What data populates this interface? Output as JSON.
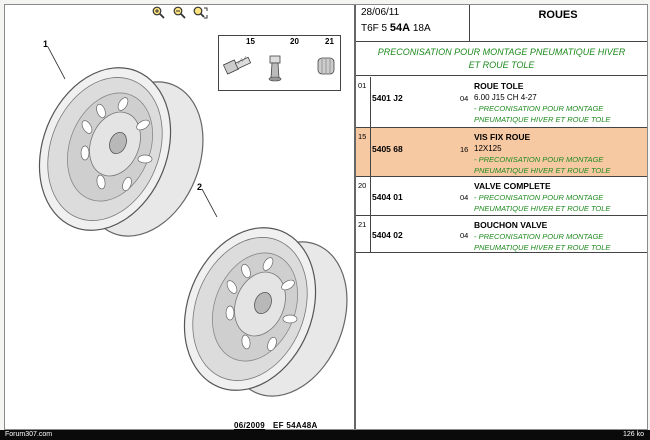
{
  "toolbar": {
    "tools": [
      {
        "name": "zoom-in-icon"
      },
      {
        "name": "zoom-out-icon"
      },
      {
        "name": "zoom-fit-icon"
      }
    ]
  },
  "drawing": {
    "callouts": [
      "1",
      "2"
    ],
    "small_parts": [
      "15",
      "20",
      "21"
    ],
    "fig_date": "06/2009",
    "fig_code": "EF 54A48A"
  },
  "header": {
    "date": "28/06/11",
    "code_prefix": "T6F 5 ",
    "code_bold": "54A",
    "code_suffix": " 18A",
    "title": "ROUES"
  },
  "preconisation": [
    "PRECONISATION POUR MONTAGE PNEUMATIQUE HIVER",
    "ET ROUE TOLE"
  ],
  "rows": [
    {
      "num": "01",
      "ref": "5401 J2",
      "qty": "04",
      "title": "ROUE TOLE",
      "lines": [
        "6.00 J15 CH 4-27"
      ],
      "notes": [
        "- PRECONISATION POUR MONTAGE",
        "PNEUMATIQUE HIVER ET ROUE TOLE"
      ],
      "highlight": false
    },
    {
      "num": "15",
      "ref": "5405 68",
      "qty": "16",
      "title": "VIS FIX ROUE",
      "lines": [
        "12X125"
      ],
      "notes": [
        "- PRECONISATION POUR MONTAGE",
        "PNEUMATIQUE HIVER ET ROUE TOLE"
      ],
      "highlight": true
    },
    {
      "num": "20",
      "ref": "5404 01",
      "qty": "04",
      "title": "VALVE COMPLETE",
      "lines": [],
      "notes": [
        "- PRECONISATION POUR MONTAGE",
        "PNEUMATIQUE HIVER ET ROUE TOLE"
      ],
      "highlight": false
    },
    {
      "num": "21",
      "ref": "5404 02",
      "qty": "04",
      "title": "BOUCHON VALVE",
      "lines": [],
      "notes": [
        "- PRECONISATION POUR MONTAGE",
        "PNEUMATIQUE HIVER ET ROUE TOLE"
      ],
      "highlight": false
    }
  ],
  "statusbar": {
    "left": "Forum307.com",
    "right": "126 ko"
  },
  "colors": {
    "note_green": "#1e8a1e",
    "highlight": "#f7c9a3"
  }
}
